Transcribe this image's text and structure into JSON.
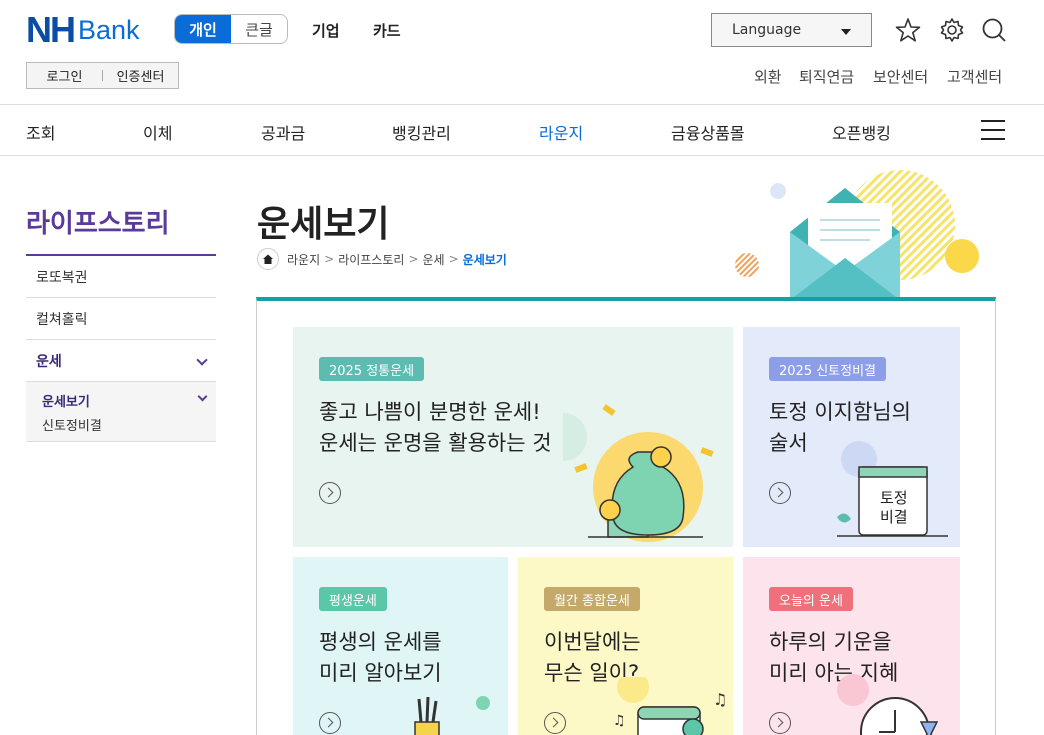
{
  "header": {
    "logo_nh": "NH",
    "logo_bank": "Bank",
    "seg_personal": "개인",
    "seg_bigfont": "큰글",
    "link_corp": "기업",
    "link_card": "카드",
    "language": "Language",
    "login": "로그인",
    "cert": "인증센터",
    "util": [
      "외환",
      "퇴직연금",
      "보안센터",
      "고객센터"
    ]
  },
  "gnb": [
    "조회",
    "이체",
    "공과금",
    "뱅킹관리",
    "라운지",
    "금융상품몰",
    "오픈뱅킹"
  ],
  "lnb": {
    "title": "라이프스토리",
    "items": [
      "로또복권",
      "컬쳐홀릭",
      "운세"
    ],
    "sub": [
      "운세보기",
      "신토정비결"
    ]
  },
  "page": {
    "title": "운세보기",
    "breadcrumb": [
      "라운지",
      "라이프스토리",
      "운세",
      "운세보기"
    ]
  },
  "cards": [
    {
      "tag": "2025 정통운세",
      "line1": "좋고 나쁨이 분명한 운세!",
      "line2": "운세는 운명을 활용하는 것"
    },
    {
      "tag": "2025 신토정비결",
      "line1": "토정 이지함님의",
      "line2": "술서",
      "book": [
        "토정",
        "비결"
      ]
    },
    {
      "tag": "평생운세",
      "line1": "평생의 운세를",
      "line2": "미리 알아보기"
    },
    {
      "tag": "월간 종합운세",
      "line1": "이번달에는",
      "line2": "무슨 일이?"
    },
    {
      "tag": "오늘의 운세",
      "line1": "하루의 기운을",
      "line2": "미리 아는 지혜"
    }
  ],
  "colors": {
    "brand": "#0a6cd8",
    "lnb": "#5a3a9a",
    "accent_line": "#14a0a6"
  }
}
